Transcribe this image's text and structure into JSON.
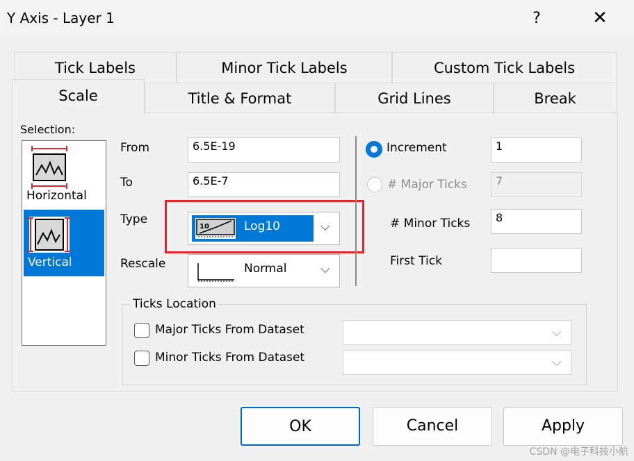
{
  "window": {
    "title": "Y Axis - Layer 1",
    "help": "?",
    "close": "✕"
  },
  "tabs_row1": [
    "Tick Labels",
    "Minor Tick Labels",
    "Custom Tick Labels"
  ],
  "tabs_row2": [
    "Scale",
    "Title & Format",
    "Grid Lines",
    "Break"
  ],
  "selection": {
    "label": "Selection:",
    "items": [
      "Horizontal",
      "Vertical"
    ],
    "selected": "Vertical"
  },
  "scale": {
    "from_label": "From",
    "from_value": "6.5E-19",
    "to_label": "To",
    "to_value": "6.5E-7",
    "type_label": "Type",
    "type_value": "Log10",
    "rescale_label": "Rescale",
    "rescale_value": "Normal"
  },
  "ticks": {
    "increment_label": "Increment",
    "increment_value": "1",
    "major_label": "# Major Ticks",
    "major_value": "7",
    "minor_label": "# Minor Ticks",
    "minor_value": "8",
    "first_label": "First Tick",
    "first_value": ""
  },
  "ticks_location": {
    "legend": "Ticks Location",
    "major_label": "Major Ticks From Dataset",
    "minor_label": "Minor Ticks From Dataset"
  },
  "buttons": {
    "ok": "OK",
    "cancel": "Cancel",
    "apply": "Apply"
  },
  "watermark": "CSDN @电子科技小航",
  "colors": {
    "highlight": "#e0262d",
    "selection_blue": "#0078d7"
  }
}
